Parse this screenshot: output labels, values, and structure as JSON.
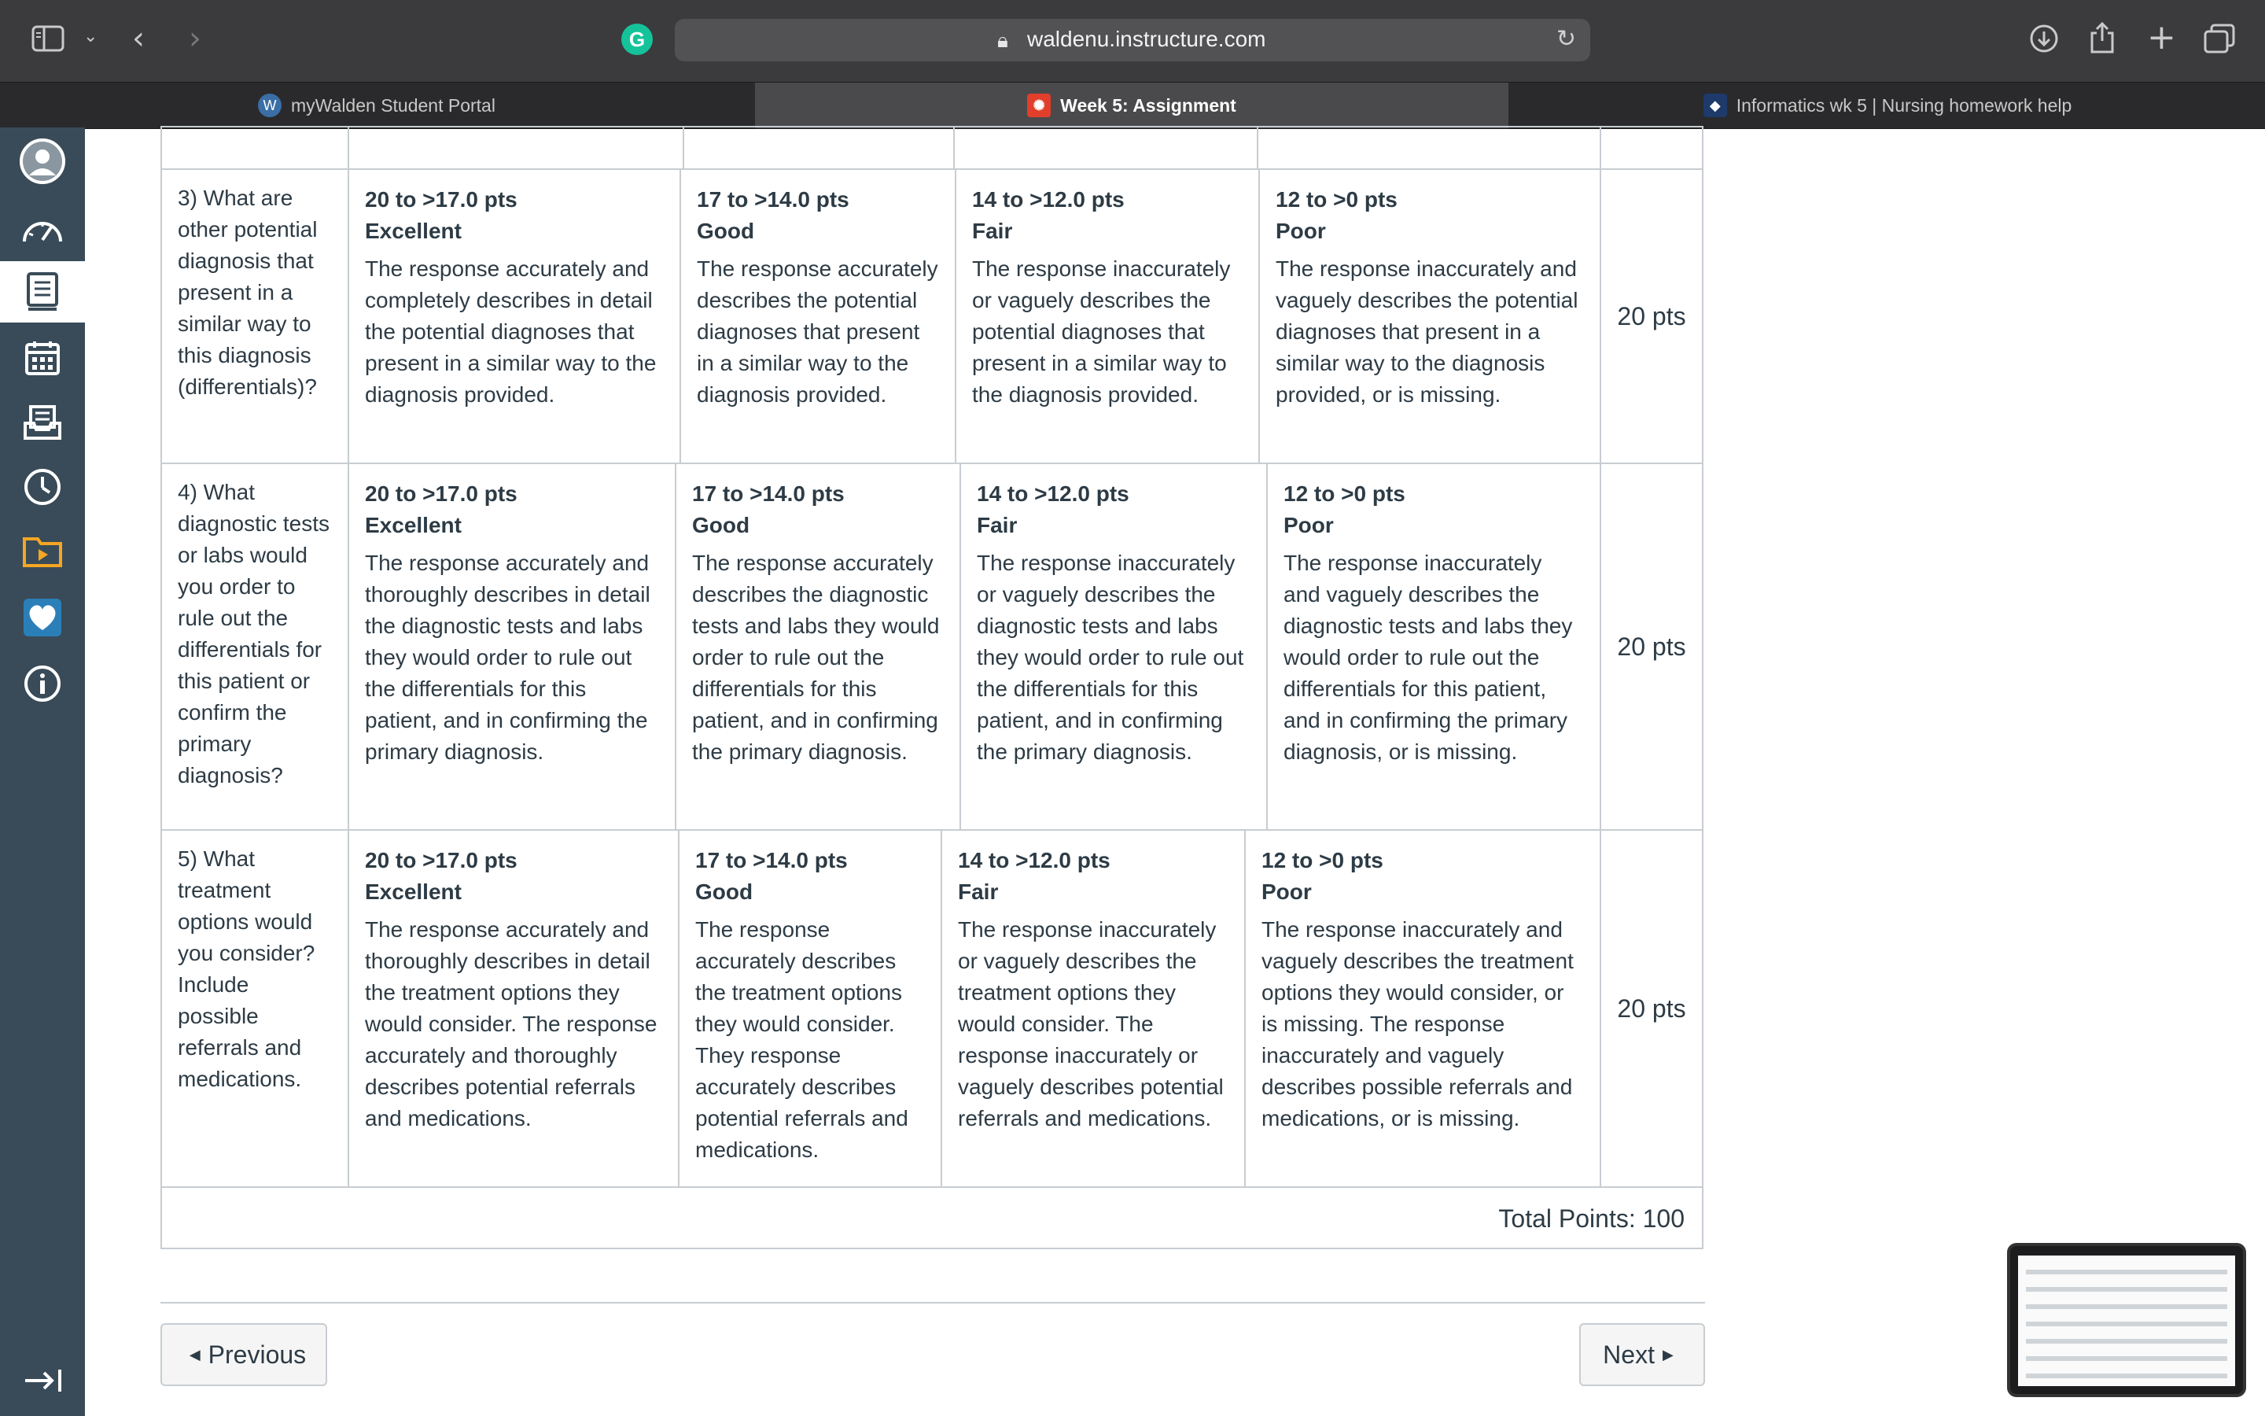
{
  "browser": {
    "url": "waldenu.instructure.com",
    "tabs": [
      {
        "label": "myWalden Student Portal",
        "icon": "walden-w-icon"
      },
      {
        "label": "Week 5: Assignment",
        "icon": "canvas-logo-icon"
      },
      {
        "label": "Informatics wk 5 | Nursing homework help",
        "icon": "site-favicon-icon"
      }
    ],
    "grammarly_letter": "G"
  },
  "rubric": {
    "rows": [
      {
        "criterion": "3) What are other potential diagnosis that present in a similar way to this diagnosis (differentials)?",
        "ratings": [
          {
            "pts": "20 to >17.0 pts",
            "label": "Excellent",
            "desc": "The response accurately and completely describes in detail the potential diagnoses that present in a similar way to the diagnosis provided."
          },
          {
            "pts": "17 to >14.0 pts",
            "label": "Good",
            "desc": "The response accurately describes the potential diagnoses that present in a similar way to the diagnosis provided."
          },
          {
            "pts": "14 to >12.0 pts",
            "label": "Fair",
            "desc": "The response inaccurately or vaguely describes the potential diagnoses that present in a similar way to the diagnosis provided."
          },
          {
            "pts": "12 to >0 pts",
            "label": "Poor",
            "desc": "The response inaccurately and vaguely describes the potential diagnoses that present in a similar way to the diagnosis provided, or is missing."
          }
        ],
        "points": "20 pts"
      },
      {
        "criterion": "4) What diagnostic tests or labs would you order to rule out the differentials for this patient or confirm the primary diagnosis?",
        "ratings": [
          {
            "pts": "20 to >17.0 pts",
            "label": "Excellent",
            "desc": "The response accurately and thoroughly describes in detail the diagnostic tests and labs they would order to rule out the differentials for this patient, and in confirming the primary diagnosis."
          },
          {
            "pts": "17 to >14.0 pts",
            "label": "Good",
            "desc": "The response accurately describes the diagnostic tests and labs they would order to rule out the differentials for this patient, and in confirming the primary diagnosis."
          },
          {
            "pts": "14 to >12.0 pts",
            "label": "Fair",
            "desc": "The response inaccurately or vaguely describes the diagnostic tests and labs they would order to rule out the differentials for this patient, and in confirming the primary diagnosis."
          },
          {
            "pts": "12 to >0 pts",
            "label": "Poor",
            "desc": "The response inaccurately and vaguely describes the diagnostic tests and labs they would order to rule out the differentials for this patient, and in confirming the primary diagnosis, or is missing."
          }
        ],
        "points": "20 pts"
      },
      {
        "criterion": "5) What treatment options would you consider? Include possible referrals and medications.",
        "ratings": [
          {
            "pts": "20 to >17.0 pts",
            "label": "Excellent",
            "desc": "The response accurately and thoroughly describes in detail the treatment options they would consider. The response accurately and thoroughly describes potential referrals and medications."
          },
          {
            "pts": "17 to >14.0 pts",
            "label": "Good",
            "desc": "The response accurately describes the treatment options they would consider. They response accurately describes potential referrals and medications."
          },
          {
            "pts": "14 to >12.0 pts",
            "label": "Fair",
            "desc": "The response inaccurately or vaguely describes the treatment options they would consider. The response inaccurately or vaguely describes potential referrals and medications."
          },
          {
            "pts": "12 to >0 pts",
            "label": "Poor",
            "desc": "The response inaccurately and vaguely describes the treatment options they would consider, or is missing. The response inaccurately and vaguely describes possible referrals and medications, or is missing."
          }
        ],
        "points": "20 pts"
      }
    ],
    "total": "Total Points: 100"
  },
  "nav": {
    "previous": "Previous",
    "next": "Next"
  },
  "colors": {
    "canvas_nav": "#394b58",
    "grammarly": "#15c39a",
    "border": "#c7cdd1"
  }
}
